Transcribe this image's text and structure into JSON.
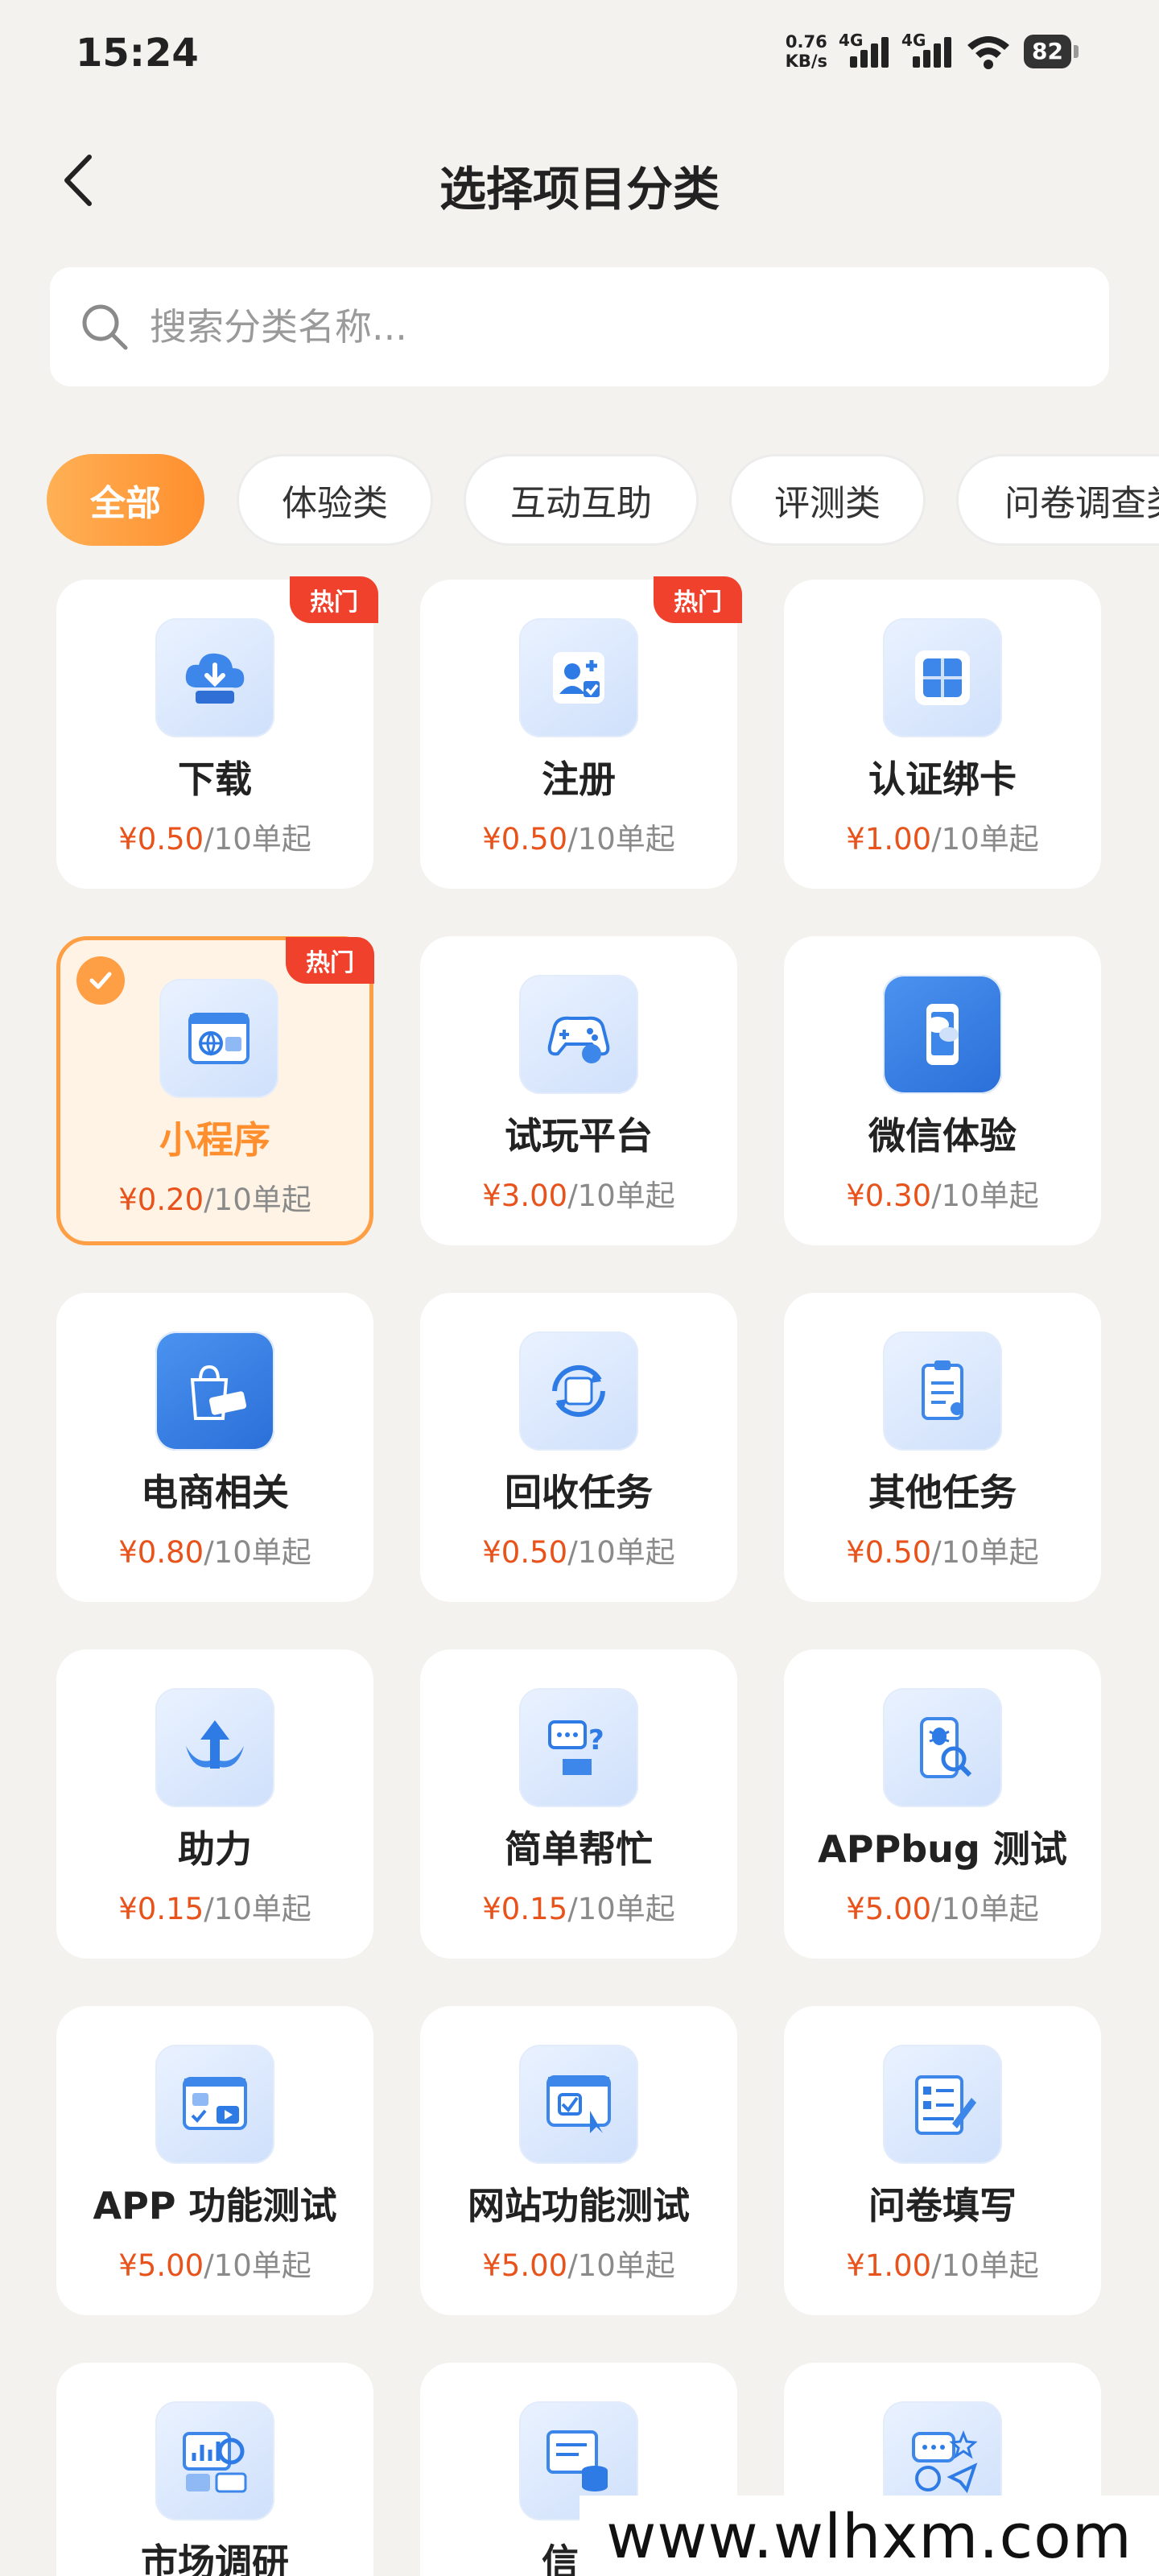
{
  "status": {
    "time": "15:24",
    "net_speed_value": "0.76",
    "net_speed_unit": "KB/s",
    "signal1_label": "4G",
    "signal2_label": "4G",
    "battery": "82"
  },
  "header": {
    "title": "选择项目分类"
  },
  "search": {
    "placeholder": "搜索分类名称..."
  },
  "tabs": [
    {
      "label": "全部",
      "active": true
    },
    {
      "label": "体验类",
      "active": false
    },
    {
      "label": "互动互助",
      "active": false
    },
    {
      "label": "评测类",
      "active": false
    },
    {
      "label": "问卷调查类",
      "active": false
    }
  ],
  "hot_label": "热门",
  "price_suffix": "/10单起",
  "categories": [
    {
      "name": "下载",
      "price": "¥0.50",
      "hot": true,
      "selected": false,
      "icon": "download-cloud-icon"
    },
    {
      "name": "注册",
      "price": "¥0.50",
      "hot": true,
      "selected": false,
      "icon": "register-user-icon"
    },
    {
      "name": "认证绑卡",
      "price": "¥1.00",
      "hot": false,
      "selected": false,
      "icon": "verify-card-icon"
    },
    {
      "name": "小程序",
      "price": "¥0.20",
      "hot": true,
      "selected": true,
      "icon": "mini-program-icon"
    },
    {
      "name": "试玩平台",
      "price": "¥3.00",
      "hot": false,
      "selected": false,
      "icon": "gamepad-icon"
    },
    {
      "name": "微信体验",
      "price": "¥0.30",
      "hot": false,
      "selected": false,
      "icon": "wechat-phone-icon"
    },
    {
      "name": "电商相关",
      "price": "¥0.80",
      "hot": false,
      "selected": false,
      "icon": "shopping-bag-icon"
    },
    {
      "name": "回收任务",
      "price": "¥0.50",
      "hot": false,
      "selected": false,
      "icon": "recycle-task-icon"
    },
    {
      "name": "其他任务",
      "price": "¥0.50",
      "hot": false,
      "selected": false,
      "icon": "clipboard-icon"
    },
    {
      "name": "助力",
      "price": "¥0.15",
      "hot": false,
      "selected": false,
      "icon": "boost-arrow-icon"
    },
    {
      "name": "简单帮忙",
      "price": "¥0.15",
      "hot": false,
      "selected": false,
      "icon": "help-chat-icon"
    },
    {
      "name": "APPbug 测试",
      "price": "¥5.00",
      "hot": false,
      "selected": false,
      "icon": "bug-test-icon"
    },
    {
      "name": "APP 功能测试",
      "price": "¥5.00",
      "hot": false,
      "selected": false,
      "icon": "app-function-icon"
    },
    {
      "name": "网站功能测试",
      "price": "¥5.00",
      "hot": false,
      "selected": false,
      "icon": "website-test-icon"
    },
    {
      "name": "问卷填写",
      "price": "¥1.00",
      "hot": false,
      "selected": false,
      "icon": "questionnaire-icon"
    },
    {
      "name": "市场调研",
      "price": "",
      "hot": false,
      "selected": false,
      "icon": "market-research-icon"
    },
    {
      "name": "信息",
      "price": "",
      "hot": false,
      "selected": false,
      "icon": "info-database-icon"
    },
    {
      "name": "",
      "price": "",
      "hot": false,
      "selected": false,
      "icon": "feedback-icon"
    }
  ],
  "watermark": "www.wlhxm.com",
  "colors": {
    "accent_orange": "#ff8f2e",
    "price_red": "#e8531c",
    "hot_red": "#f0412d",
    "icon_blue": "#2f7be6"
  }
}
